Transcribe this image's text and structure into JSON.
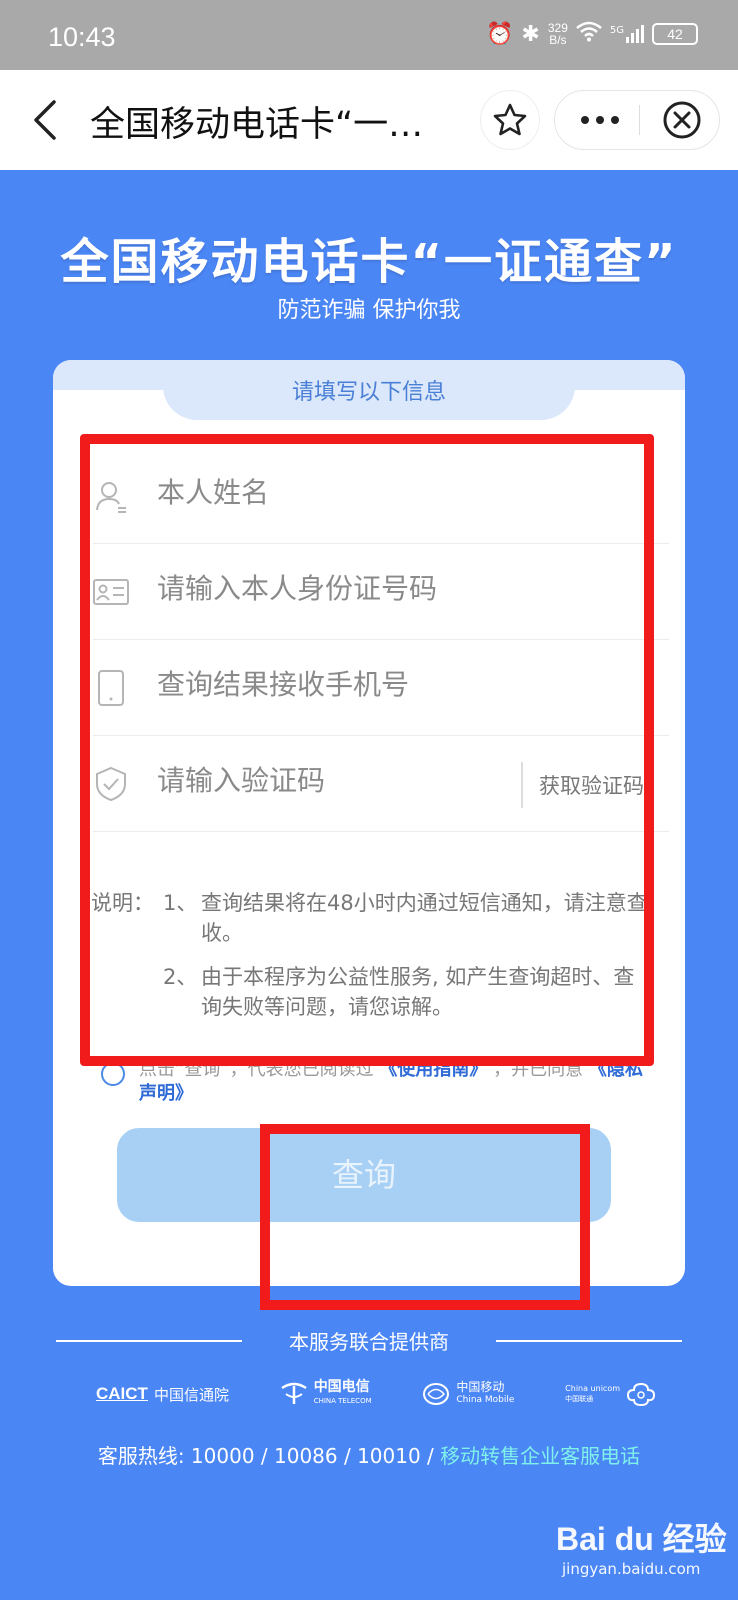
{
  "status_bar": {
    "time": "10:43",
    "net_speed_value": "329",
    "net_speed_unit": "B/s",
    "signal_label": "5G",
    "battery": "42"
  },
  "nav": {
    "title": "全国移动电话卡“一…",
    "back_icon": "chevron-left-icon",
    "star_icon": "star-icon",
    "more_icon": "more-dots-icon",
    "close_icon": "close-circle-icon"
  },
  "hero": {
    "title": "全国移动电话卡“一证通查”",
    "subtitle": "防范诈骗 保护你我"
  },
  "form": {
    "tab_label": "请填写以下信息",
    "name_placeholder": "本人姓名",
    "id_placeholder": "请输入本人身份证号码",
    "phone_placeholder": "查询结果接收手机号",
    "code_placeholder": "请输入验证码",
    "get_code_label": "获取验证码"
  },
  "notes": {
    "label": "说明：",
    "items": [
      {
        "num": "1、",
        "text": "查询结果将在48小时内通过短信通知，请注意查收。"
      },
      {
        "num": "2、",
        "text": "由于本程序为公益性服务, 如产生查询超时、查询失败等问题，请您谅解。"
      }
    ]
  },
  "agreement": {
    "prefix": "点击“查询”，代表您已阅读过",
    "guide_link": "《使用指南》",
    "middle": "，并已同意",
    "privacy_link": "《隐私声明》"
  },
  "query_button": "查询",
  "providers": {
    "title": "本服务联合提供商",
    "logos": [
      {
        "name": "CAICT",
        "label": "中国信通院"
      },
      {
        "name": "中国电信",
        "label": "CHINA TELECOM"
      },
      {
        "name": "中国移动",
        "label": "China Mobile"
      },
      {
        "name": "China unicom",
        "label": "中国联通"
      }
    ]
  },
  "hotline": {
    "prefix": "客服热线: 10000 / 10086 / 10010 /",
    "link": "移动转售企业客服电话"
  },
  "watermark": {
    "main": "Bai du 经验",
    "sub": "jingyan.baidu.com"
  },
  "colors": {
    "background": "#4b86f5",
    "highlight_red": "#f21b1b",
    "button_disabled": "#a8d0f5",
    "link_blue": "#2f6bd6"
  }
}
